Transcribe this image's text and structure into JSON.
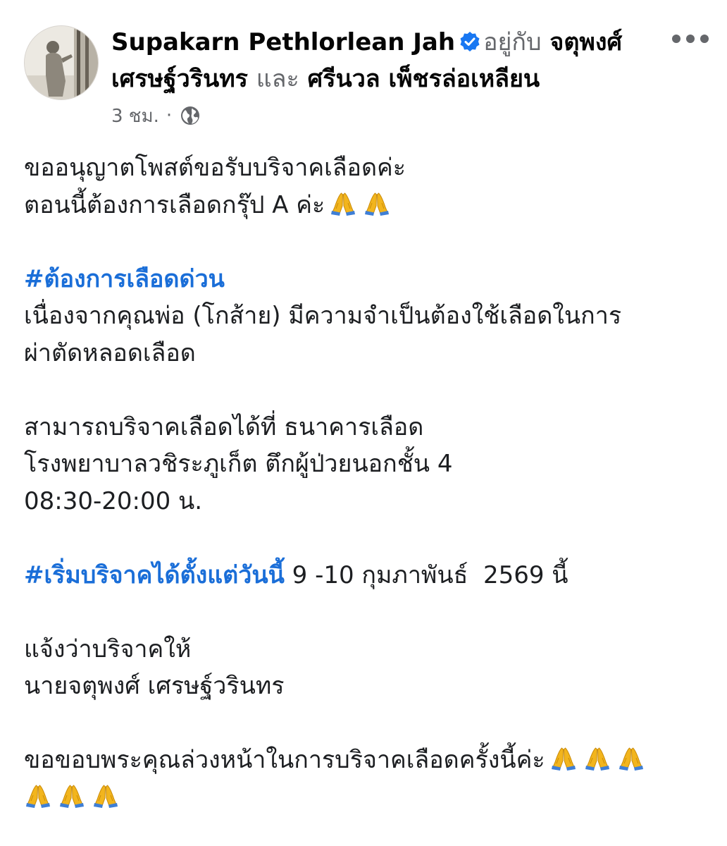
{
  "post": {
    "author": "Supakarn Pethlorlean Jah",
    "with_text": "อยู่กับ",
    "tagged_1_line1": "จตุพงศ์",
    "tagged_1_line2": "เศรษฐ์วรินทร",
    "and_text": "และ",
    "tagged_2": "ศรีนวล เพ็ชรล่อเหลียน",
    "time": "3 ชม.",
    "separator": "·",
    "privacy_icon": "globe-icon",
    "verified_icon": "verified-badge-icon",
    "more_icon": "more-options-icon"
  },
  "content": {
    "line1": "ขออนุญาตโพสต์ขอรับบริจาคเลือดค่ะ",
    "line2": "ตอนนี้ต้องการเลือดกรุ๊ป A ค่ะ",
    "hashtag1": "#ต้องการเลือดด่วน",
    "line3": "เนื่องจากคุณพ่อ (โกส้าย) มีความจำเป็นต้องใช้เลือดในการ",
    "line4": "ผ่าตัดหลอดเลือด",
    "line5": "สามารถบริจาคเลือดได้ที่ ธนาคารเลือด",
    "line6": "โรงพยาบาลวชิระภูเก็ต ตึกผู้ป่วยนอกชั้น 4",
    "line7": "08:30-20:00 น.",
    "hashtag2": "#เริ่มบริจาคได้ตั้งแต่วันนี้",
    "hashtag2_rest": " 9 -10 กุมภาพันธ์  2569 นี้",
    "line8": "แจ้งว่าบริจาคให้",
    "line9": "นายจตุพงศ์ เศรษฐ์วรินทร",
    "line10": "ขอขอบพระคุณล่วงหน้าในการบริจาคเลือดครั้งนี้ค่ะ",
    "emoji": "folded-hands-emoji"
  },
  "colors": {
    "hashtag": "#1a6ed8",
    "verified": "#1877f2",
    "meta_text": "#65676b"
  }
}
